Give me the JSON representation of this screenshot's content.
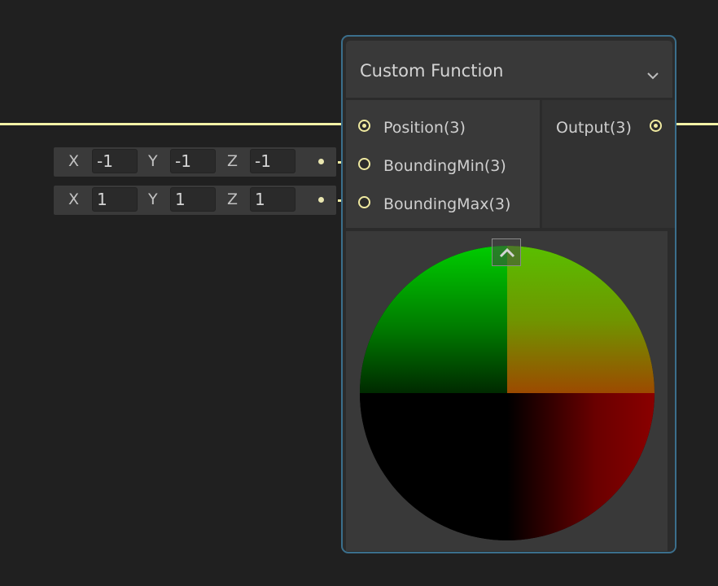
{
  "node": {
    "title": "Custom Function",
    "inputs": [
      {
        "label": "Position(3)"
      },
      {
        "label": "BoundingMin(3)"
      },
      {
        "label": "BoundingMax(3)"
      }
    ],
    "outputs": [
      {
        "label": "Output(3)"
      }
    ]
  },
  "vector_fields": {
    "bounding_min": {
      "x_label": "X",
      "x": "-1",
      "y_label": "Y",
      "y": "-1",
      "z_label": "Z",
      "z": "-1"
    },
    "bounding_max": {
      "x_label": "X",
      "x": "1",
      "y_label": "Y",
      "y": "1",
      "z_label": "Z",
      "z": "1"
    }
  },
  "colors": {
    "wire": "#f3f2a6",
    "node_border": "#3b6f8c",
    "background": "#202020"
  },
  "icons": {
    "collapse": "chevron-down-icon",
    "preview_toggle": "chevron-up-icon"
  }
}
